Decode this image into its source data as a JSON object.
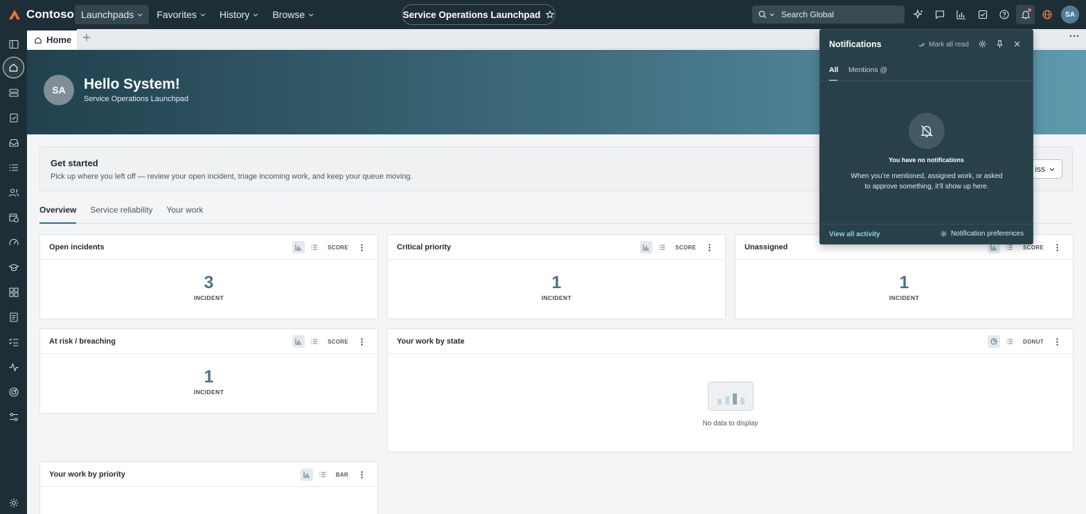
{
  "brand": {
    "name": "Contoso"
  },
  "topnav": {
    "menus": [
      {
        "label": "Launchpads"
      },
      {
        "label": "Favorites"
      },
      {
        "label": "History"
      },
      {
        "label": "Browse"
      }
    ],
    "launchpad_title": "Service Operations Launchpad",
    "search_placeholder": "Search Global",
    "user_initials": "SA"
  },
  "tabstrip": {
    "home_label": "Home"
  },
  "banner": {
    "initials": "SA",
    "greeting": "Hello System!",
    "subtitle": "Service Operations Launchpad"
  },
  "get_started": {
    "title": "Get started",
    "text": "Pick up where you left off — review your open incident, triage incoming work, and keep your queue moving.",
    "button_label": "iss"
  },
  "dashboard_tabs": [
    {
      "label": "Overview"
    },
    {
      "label": "Service reliability"
    },
    {
      "label": "Your work"
    }
  ],
  "cards": {
    "open_incidents": {
      "title": "Open incidents",
      "mode": "SCORE",
      "value": "3",
      "unit": "INCIDENT"
    },
    "critical_priority": {
      "title": "Critical priority",
      "mode": "SCORE",
      "value": "1",
      "unit": "INCIDENT"
    },
    "unassigned": {
      "title": "Unassigned",
      "mode": "SCORE",
      "value": "1",
      "unit": "INCIDENT"
    },
    "at_risk": {
      "title": "At risk / breaching",
      "mode": "SCORE",
      "value": "1",
      "unit": "INCIDENT"
    },
    "work_by_state": {
      "title": "Your work by state",
      "mode": "DONUT",
      "empty_text": "No data to display"
    },
    "work_by_priority": {
      "title": "Your work by priority",
      "mode": "BAR"
    }
  },
  "notifications": {
    "title": "Notifications",
    "mark_all_read": "Mark all read",
    "tabs": [
      {
        "label": "All"
      },
      {
        "label": "Mentions @"
      }
    ],
    "empty_title": "You have no notifications",
    "empty_text": "When you’re mentioned, assigned work, or asked to approve something, it’ll show up here.",
    "view_all": "View all activity",
    "preferences": "Notification preferences"
  },
  "colors": {
    "nav_bg": "#1e2e36",
    "panel_bg": "#28404a",
    "accent": "#2f6f81",
    "score_value": "#4a7486",
    "brand_mark": "#ff6a3d"
  }
}
